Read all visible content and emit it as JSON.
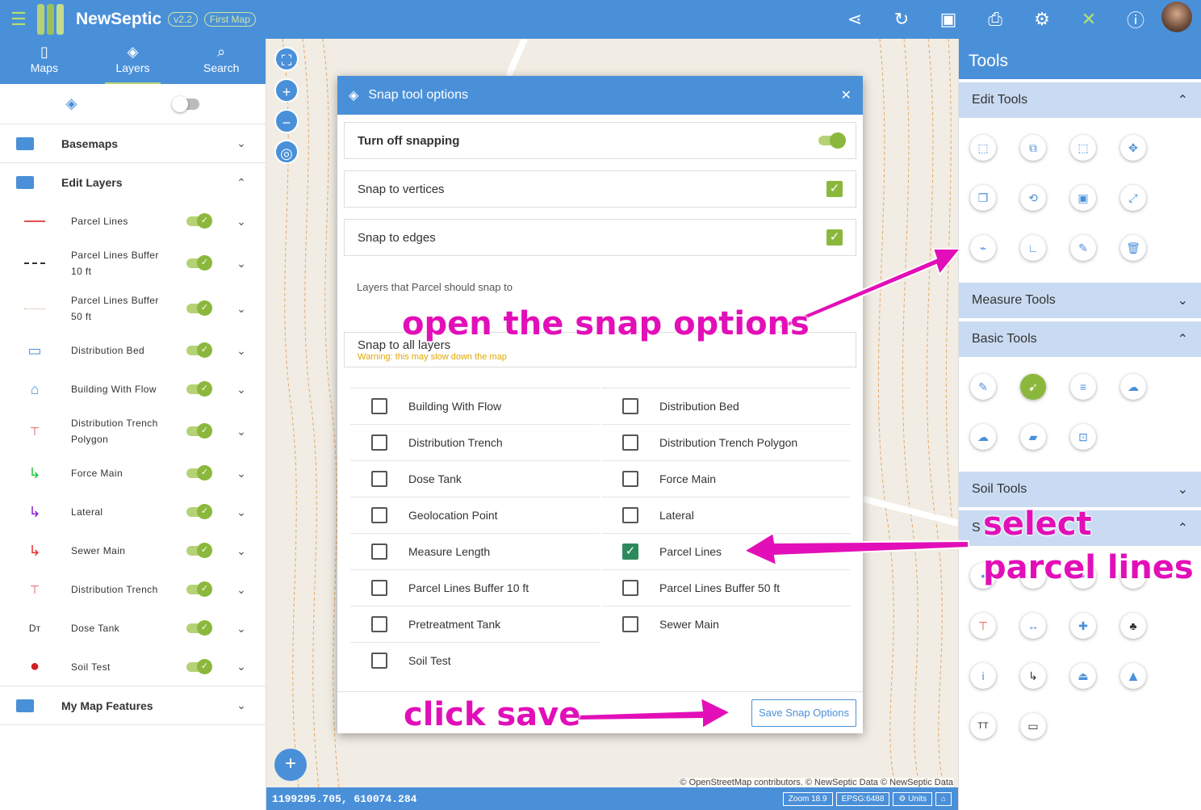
{
  "app": {
    "name": "NewSeptic",
    "version": "v2.2",
    "map_name": "First Map"
  },
  "left_tabs": [
    {
      "label": "Maps"
    },
    {
      "label": "Layers"
    },
    {
      "label": "Search"
    }
  ],
  "groups": {
    "basemaps": "Basemaps",
    "edit_layers": "Edit Layers",
    "my_map_features": "My Map Features"
  },
  "layers": [
    {
      "name": "Parcel Lines"
    },
    {
      "name": "Parcel Lines Buffer 10 ft"
    },
    {
      "name": "Parcel Lines Buffer 50 ft"
    },
    {
      "name": "Distribution Bed"
    },
    {
      "name": "Building With Flow"
    },
    {
      "name": "Distribution Trench Polygon"
    },
    {
      "name": "Force Main"
    },
    {
      "name": "Lateral"
    },
    {
      "name": "Sewer Main"
    },
    {
      "name": "Distribution Trench"
    },
    {
      "name": "Dose Tank"
    },
    {
      "name": "Soil Test"
    }
  ],
  "dialog": {
    "title": "Snap tool options",
    "turn_off": "Turn off snapping",
    "vertices": "Snap to vertices",
    "edges": "Snap to edges",
    "layers_label": "Layers that Parcel should snap to",
    "snap_all": "Snap to all layers",
    "warning": "Warning: this may slow down the map",
    "save": "Save Snap Options",
    "options": [
      {
        "label": "Building With Flow",
        "checked": false
      },
      {
        "label": "Distribution Bed",
        "checked": false
      },
      {
        "label": "Distribution Trench",
        "checked": false
      },
      {
        "label": "Distribution Trench Polygon",
        "checked": false
      },
      {
        "label": "Dose Tank",
        "checked": false
      },
      {
        "label": "Force Main",
        "checked": false
      },
      {
        "label": "Geolocation Point",
        "checked": false
      },
      {
        "label": "Lateral",
        "checked": false
      },
      {
        "label": "Measure Length",
        "checked": false
      },
      {
        "label": "Parcel Lines",
        "checked": true
      },
      {
        "label": "Parcel Lines Buffer 10 ft",
        "checked": false
      },
      {
        "label": "Parcel Lines Buffer 50 ft",
        "checked": false
      },
      {
        "label": "Pretreatment Tank",
        "checked": false
      },
      {
        "label": "Sewer Main",
        "checked": false
      },
      {
        "label": "Soil Test",
        "checked": false
      }
    ]
  },
  "tools": {
    "title": "Tools",
    "edit": "Edit Tools",
    "measure": "Measure Tools",
    "basic": "Basic Tools",
    "soil": "Soil Tools",
    "s_prefix": "S"
  },
  "status": {
    "coords": "1199295.705, 610074.284",
    "zoom": "Zoom 18.9",
    "epsg": "EPSG:6488",
    "units": "Units",
    "attribution": "© OpenStreetMap contributors. © NewSeptic Data © NewSeptic Data"
  },
  "annotations": {
    "open": "open the snap options",
    "select1": "select",
    "select2": "parcel lines",
    "save": "click save"
  },
  "colors": {
    "primary": "#4a90d9",
    "accent": "#b5d276",
    "annotation": "#e20fb8"
  }
}
